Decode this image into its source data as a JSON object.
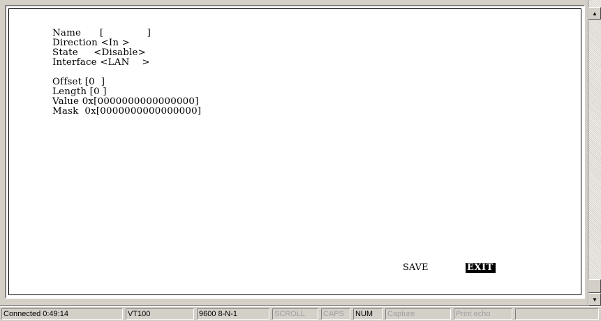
{
  "terminal": {
    "lines": [
      "Name      [              ]",
      "Direction <In >",
      "State     <Disable>",
      "Interface <LAN    >",
      "",
      "Offset [0  ]",
      "Length [0 ]",
      "Value 0x[0000000000000000]",
      "Mask  0x[0000000000000000]"
    ],
    "commands": {
      "save": "SAVE",
      "exit": "EXIT"
    }
  },
  "scrollbar": {
    "up_icon": "scroll-up-arrow",
    "down_icon": "scroll-down-arrow"
  },
  "statusbar": {
    "connected": "Connected 0:49:14",
    "emulation": "VT100",
    "port_settings": "9600 8-N-1",
    "scroll": "SCROLL",
    "caps": "CAPS",
    "num": "NUM",
    "capture": "Capture",
    "print_echo": "Print echo"
  }
}
